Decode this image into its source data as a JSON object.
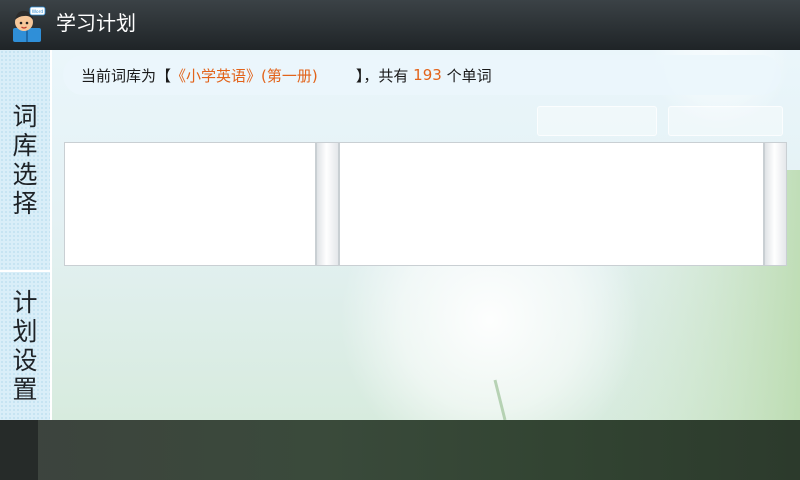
{
  "app": {
    "title": "学习计划",
    "icon": "student-reading-icon",
    "icon_badge": "Word"
  },
  "sidebar": {
    "tabs": [
      {
        "label_chars": [
          "词",
          "库",
          "选",
          "择"
        ]
      },
      {
        "label_chars": [
          "计",
          "划",
          "设",
          "置"
        ]
      }
    ]
  },
  "info": {
    "prefix": "当前词库为【",
    "book_name": "《小学英语》(第一册)",
    "suffix": "        】，共有 ",
    "count": "193",
    "unit": " 个单词"
  },
  "colors": {
    "accent": "#e2631a",
    "titlebar": "#2b3134",
    "sidebar": "#d9eef8"
  }
}
